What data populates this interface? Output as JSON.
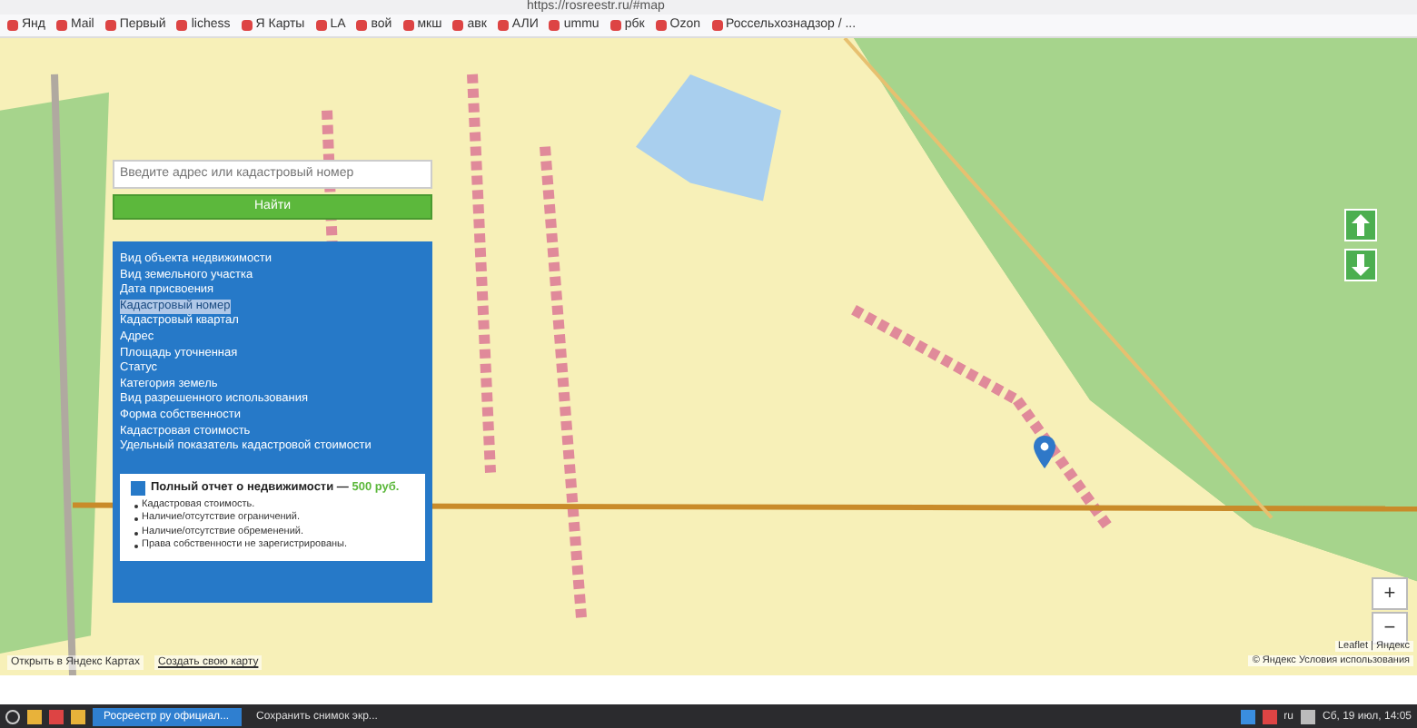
{
  "browser": {
    "address": "https://rosreestr.ru/#map",
    "bookmarks": [
      "Янд",
      "Mail",
      "Первый",
      "lichess",
      "Я Карты",
      "LA",
      "вой",
      "мкш",
      "авк",
      "АЛИ",
      "ummu",
      "рбк",
      "Ozon",
      "Россельхознадзор / ..."
    ]
  },
  "search": {
    "placeholder": "Введите адрес или кадастровый номер",
    "button": "Найти"
  },
  "info": {
    "fields": [
      {
        "label": "Вид объекта недвижимости",
        "highlighted": false
      },
      {
        "label": "Вид земельного участка",
        "highlighted": false
      },
      {
        "label": "Дата присвоения",
        "highlighted": false
      },
      {
        "label": "Кадастровый номер",
        "highlighted": true
      },
      {
        "label": "Кадастровый квартал",
        "highlighted": false
      },
      {
        "label": "Адрес",
        "highlighted": false
      },
      {
        "label": "Площадь уточненная",
        "highlighted": false
      },
      {
        "label": "Статус",
        "highlighted": false
      },
      {
        "label": "Категория земель",
        "highlighted": false
      },
      {
        "label": "Вид разрешенного использования",
        "highlighted": false
      },
      {
        "label": "Форма собственности",
        "highlighted": false
      },
      {
        "label": "Кадастровая стоимость",
        "highlighted": false
      },
      {
        "label": "Удельный показатель кадастровой стоимости",
        "highlighted": false
      }
    ],
    "report": {
      "checked": true,
      "title": "Полный отчет о недвижимости — **500 руб.**",
      "items": [
        "Кадастровая стоимость.",
        "Наличие/отсутствие ограничений.",
        "Наличие/отсутствие обременений.",
        "Права собственности не зарегистрированы."
      ]
    }
  },
  "map": {
    "zoom_in": "+",
    "zoom_out": "−",
    "open_link": "Открыть в Яндекс Картах",
    "create_link": "Создать свою карту",
    "attribution": "Leaflet | Яндекс",
    "terms": "© Яндекс Условия использования"
  },
  "taskbar": {
    "windows": [
      {
        "title": "Росреестр ру официал...",
        "selected": true
      },
      {
        "title": "Сохранить снимок экр...",
        "selected": false
      }
    ],
    "lang": "ru",
    "clock": "Сб, 19 июл, 14:05"
  }
}
